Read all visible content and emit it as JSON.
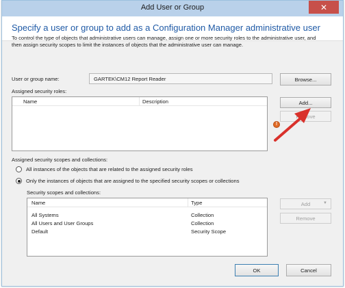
{
  "window": {
    "title": "Add User or Group",
    "close_glyph": "✕"
  },
  "header": {
    "heading": "Specify a user or group to add as a Configuration Manager administrative user"
  },
  "info": {
    "line1": "To control the type of objects that administrative users can manage, assign one or more security roles  to the  administrative user, and",
    "line2": "then assign security scopes to limit the instances of objects that the administrative user can manage."
  },
  "user_field": {
    "label": "User or group name:",
    "value": "GARTEK\\CM12 Report Reader",
    "browse_label": "Browse..."
  },
  "roles": {
    "label": "Assigned security roles:",
    "columns": [
      "Name",
      "Description"
    ],
    "add_label": "Add...",
    "remove_label": "Remove"
  },
  "scopes": {
    "label": "Assigned security scopes and collections:",
    "option_all": "All instances of the objects that are related to the assigned security roles",
    "option_only": "Only the instances of objects that are assigned to the specified security scopes or collections",
    "selected": "only"
  },
  "scope_list": {
    "label": "Security scopes and collections:",
    "columns": [
      "Name",
      "Type"
    ],
    "rows": [
      {
        "name": "All Systems",
        "type": "Collection"
      },
      {
        "name": "All Users and User Groups",
        "type": "Collection"
      },
      {
        "name": "Default",
        "type": "Security Scope"
      }
    ],
    "add_label": "Add",
    "remove_label": "Remove"
  },
  "footer": {
    "ok_label": "OK",
    "cancel_label": "Cancel"
  },
  "colors": {
    "heading": "#1f5aa6",
    "titlebar": "#b9d1ea",
    "close": "#c7504a",
    "annotation_arrow": "#d9312b",
    "warning": "#e06a25"
  },
  "icons": {
    "close": "close-icon",
    "warning": "warning-icon",
    "dropdown": "chevron-down-icon",
    "annotation": "red-arrow-annotation"
  }
}
